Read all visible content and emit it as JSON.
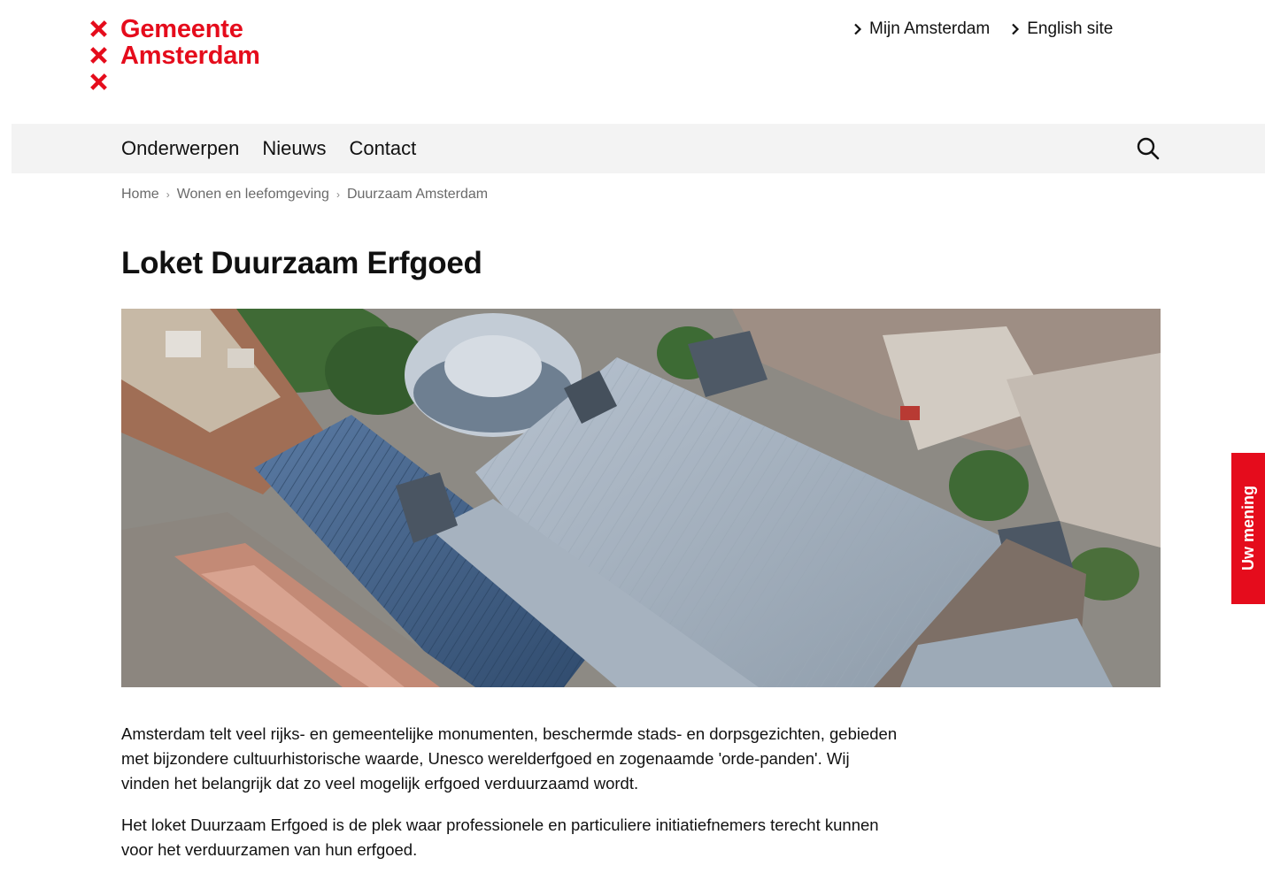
{
  "logo": {
    "line1": "Gemeente",
    "line2": "Amsterdam"
  },
  "top_links": [
    {
      "label": "Mijn Amsterdam"
    },
    {
      "label": "English site"
    }
  ],
  "nav": {
    "items": [
      {
        "label": "Onderwerpen"
      },
      {
        "label": "Nieuws"
      },
      {
        "label": "Contact"
      }
    ],
    "search_icon": "search-icon"
  },
  "breadcrumb": [
    {
      "label": "Home"
    },
    {
      "label": "Wonen en leefomgeving"
    },
    {
      "label": "Duurzaam Amsterdam"
    }
  ],
  "page": {
    "title": "Loket Duurzaam Erfgoed",
    "paragraphs": [
      "Amsterdam telt veel rijks- en gemeentelijke monumenten, beschermde stads- en dorpsgezichten, gebieden met bijzondere cultuurhistorische waarde, Unesco werelderfgoed en zogenaamde 'orde-panden'. Wij vinden het belangrijk dat zo veel mogelijk erfgoed verduurzaamd wordt.",
      "Het loket Duurzaam Erfgoed is de plek waar professionele en particuliere initiatiefnemers terecht kunnen voor het verduurzamen van hun erfgoed."
    ]
  },
  "feedback": {
    "label": "Uw mening"
  },
  "colors": {
    "brand_red": "#e50c1c",
    "nav_bg": "#f3f3f3",
    "text": "#111111",
    "muted": "#6a6a6a"
  }
}
